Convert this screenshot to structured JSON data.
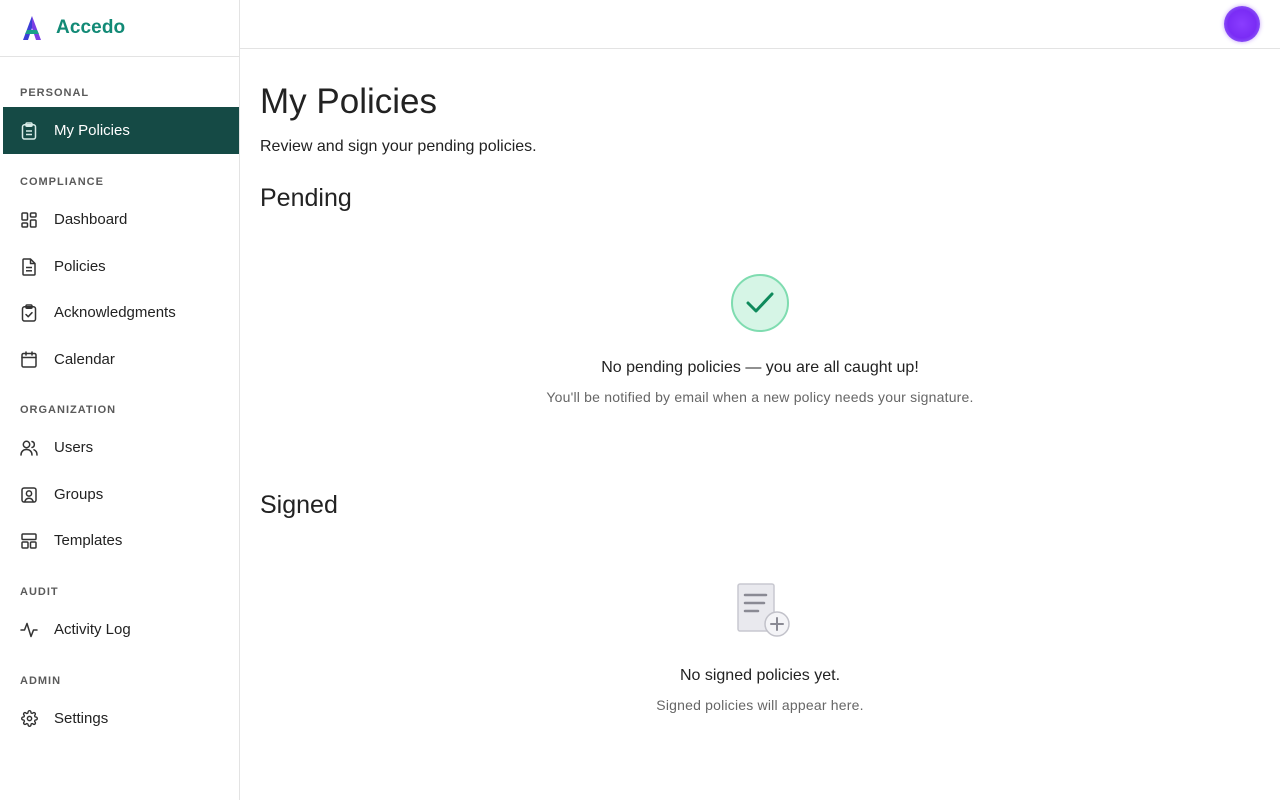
{
  "brand": {
    "name": "Accedo",
    "logo_icon": "accedo-logo-icon",
    "color": "#128a76"
  },
  "sidebar": {
    "sections": [
      {
        "label": "PERSONAL",
        "items": [
          {
            "label": "My Policies",
            "icon": "clipboard-icon",
            "active": true
          }
        ]
      },
      {
        "label": "COMPLIANCE",
        "items": [
          {
            "label": "Dashboard",
            "icon": "dashboard-grid-icon"
          },
          {
            "label": "Policies",
            "icon": "document-icon"
          },
          {
            "label": "Acknowledgments",
            "icon": "clipboard-check-icon"
          },
          {
            "label": "Calendar",
            "icon": "calendar-icon"
          }
        ]
      },
      {
        "label": "ORGANIZATION",
        "items": [
          {
            "label": "Users",
            "icon": "users-icon"
          },
          {
            "label": "Groups",
            "icon": "user-square-icon"
          },
          {
            "label": "Templates",
            "icon": "templates-icon"
          }
        ]
      },
      {
        "label": "AUDIT",
        "items": [
          {
            "label": "Activity Log",
            "icon": "activity-icon"
          }
        ]
      },
      {
        "label": "ADMIN",
        "items": [
          {
            "label": "Settings",
            "icon": "gear-icon"
          }
        ]
      }
    ],
    "active_color": "#154a45"
  },
  "topbar": {
    "avatar_icon": "user-avatar",
    "avatar_color": "#7a2cf5"
  },
  "main": {
    "title": "My Policies",
    "subtitle": "Review and sign your pending policies.",
    "pending": {
      "title": "Pending",
      "empty_title": "No pending policies — you are all caught up!",
      "empty_sub": "You'll be notified by email when a new policy needs your signature.",
      "icon": "check-circle-icon"
    },
    "signed": {
      "title": "Signed",
      "empty_title": "No signed policies yet.",
      "empty_sub": "Signed policies will appear here.",
      "icon": "document-plus-icon"
    }
  }
}
